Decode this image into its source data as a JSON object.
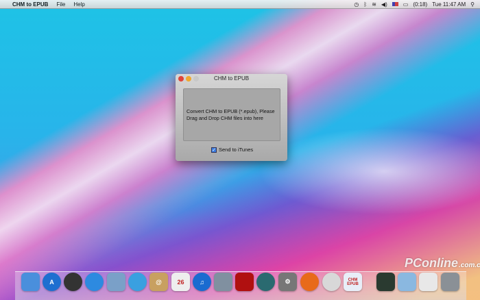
{
  "menubar": {
    "app_name": "CHM to EPUB",
    "menus": [
      "File",
      "Help"
    ],
    "battery": "(0:18)",
    "clock": "Tue 11:47 AM"
  },
  "window": {
    "title": "CHM to EPUB",
    "drop_text": "Convert CHM to EPUB (*.epub), Please Drag and Drop CHM files into here",
    "checkbox_label": "Send to iTunes",
    "checkbox_checked": true
  },
  "dock": {
    "items": [
      {
        "name": "finder",
        "color": "#4a8fdc",
        "label": ""
      },
      {
        "name": "app-store",
        "color": "#1e6fd0",
        "label": "A"
      },
      {
        "name": "dashboard",
        "color": "#333333",
        "label": ""
      },
      {
        "name": "facetime",
        "color": "#2d8ae0",
        "label": ""
      },
      {
        "name": "preview",
        "color": "#7aa0c8",
        "label": ""
      },
      {
        "name": "safari",
        "color": "#3aa0e0",
        "label": ""
      },
      {
        "name": "address-book",
        "color": "#c8a060",
        "label": "@"
      },
      {
        "name": "ical",
        "color": "#eeeeee",
        "label": "26"
      },
      {
        "name": "itunes",
        "color": "#1a6bd0",
        "label": "♫"
      },
      {
        "name": "iphoto",
        "color": "#8090a0",
        "label": ""
      },
      {
        "name": "photo-booth",
        "color": "#b01010",
        "label": ""
      },
      {
        "name": "time-machine",
        "color": "#2a6a70",
        "label": ""
      },
      {
        "name": "system-preferences",
        "color": "#777777",
        "label": "⚙"
      },
      {
        "name": "firefox",
        "color": "#e86a1a",
        "label": ""
      },
      {
        "name": "chrome",
        "color": "#d8d8d8",
        "label": ""
      },
      {
        "name": "chm-to-epub",
        "color": "#e8eef8",
        "label": "CHM EPUB"
      },
      {
        "name": "activity-monitor",
        "color": "#2a3a30",
        "label": ""
      },
      {
        "name": "documents-folder",
        "color": "#8ab8e0",
        "label": ""
      },
      {
        "name": "downloads-stack",
        "color": "#e8e8e8",
        "label": ""
      },
      {
        "name": "trash",
        "color": "#8a9096",
        "label": ""
      }
    ]
  },
  "watermark": {
    "text": "PConline",
    "sub": ".com.cn"
  }
}
